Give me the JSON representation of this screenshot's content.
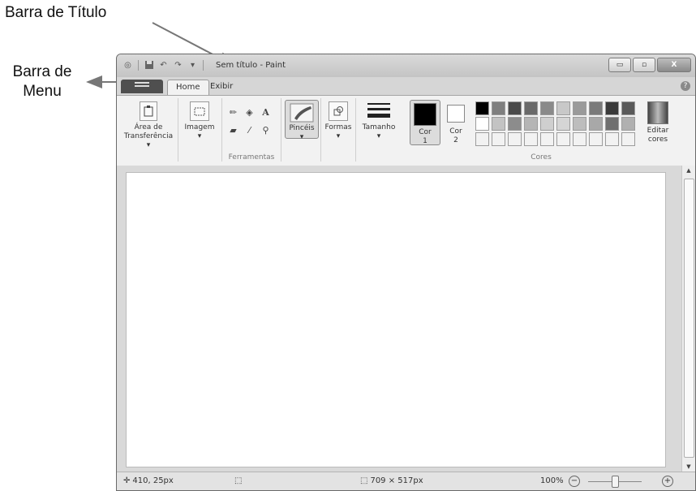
{
  "annotations": {
    "title_bar": "Barra de Título",
    "menu_bar_line1": "Barra de",
    "menu_bar_line2": "Menu"
  },
  "window": {
    "title": "Sem título - Paint",
    "buttons": {
      "minimize": "▭",
      "maximize": "▫",
      "close": "X"
    }
  },
  "tabs": {
    "home": "Home",
    "view": "Exibir"
  },
  "ribbon": {
    "clipboard": {
      "line1": "Área de",
      "line2": "Transferência ▾"
    },
    "image": {
      "label": "Imagem",
      "arrow": "▾"
    },
    "tools_group": "Ferramentas",
    "brushes": {
      "label": "Pincéis",
      "arrow": "▾"
    },
    "shapes": {
      "label": "Formas",
      "arrow": "▾"
    },
    "size": {
      "label": "Tamanho",
      "arrow": "▾"
    },
    "color1": {
      "line1": "Cor",
      "line2": "1"
    },
    "color2": {
      "line1": "Cor",
      "line2": "2"
    },
    "colors_group": "Cores",
    "edit_colors": {
      "line1": "Editar",
      "line2": "cores"
    }
  },
  "palette": [
    [
      "#000000",
      "#7f7f7f",
      "#4a4a4a",
      "#6a6a6a",
      "#8a8a8a",
      "#c8c8c8",
      "#9a9a9a",
      "#7a7a7a",
      "#3a3a3a",
      "#5a5a5a"
    ],
    [
      "#ffffff",
      "#c3c3c3",
      "#8c8c8c",
      "#b5b5b5",
      "#cfcfcf",
      "#d5d5d5",
      "#bdbdbd",
      "#a8a8a8",
      "#6f6f6f",
      "#b0b0b0"
    ],
    [
      "#f2f2f2",
      "#f2f2f2",
      "#f2f2f2",
      "#f2f2f2",
      "#f2f2f2",
      "#f2f2f2",
      "#f2f2f2",
      "#f2f2f2",
      "#f2f2f2",
      "#f2f2f2"
    ]
  ],
  "status": {
    "cursor_pos": "410, 25px",
    "canvas_size": "709 × 517px",
    "zoom": "100%",
    "zoom_fraction": 0.5
  }
}
